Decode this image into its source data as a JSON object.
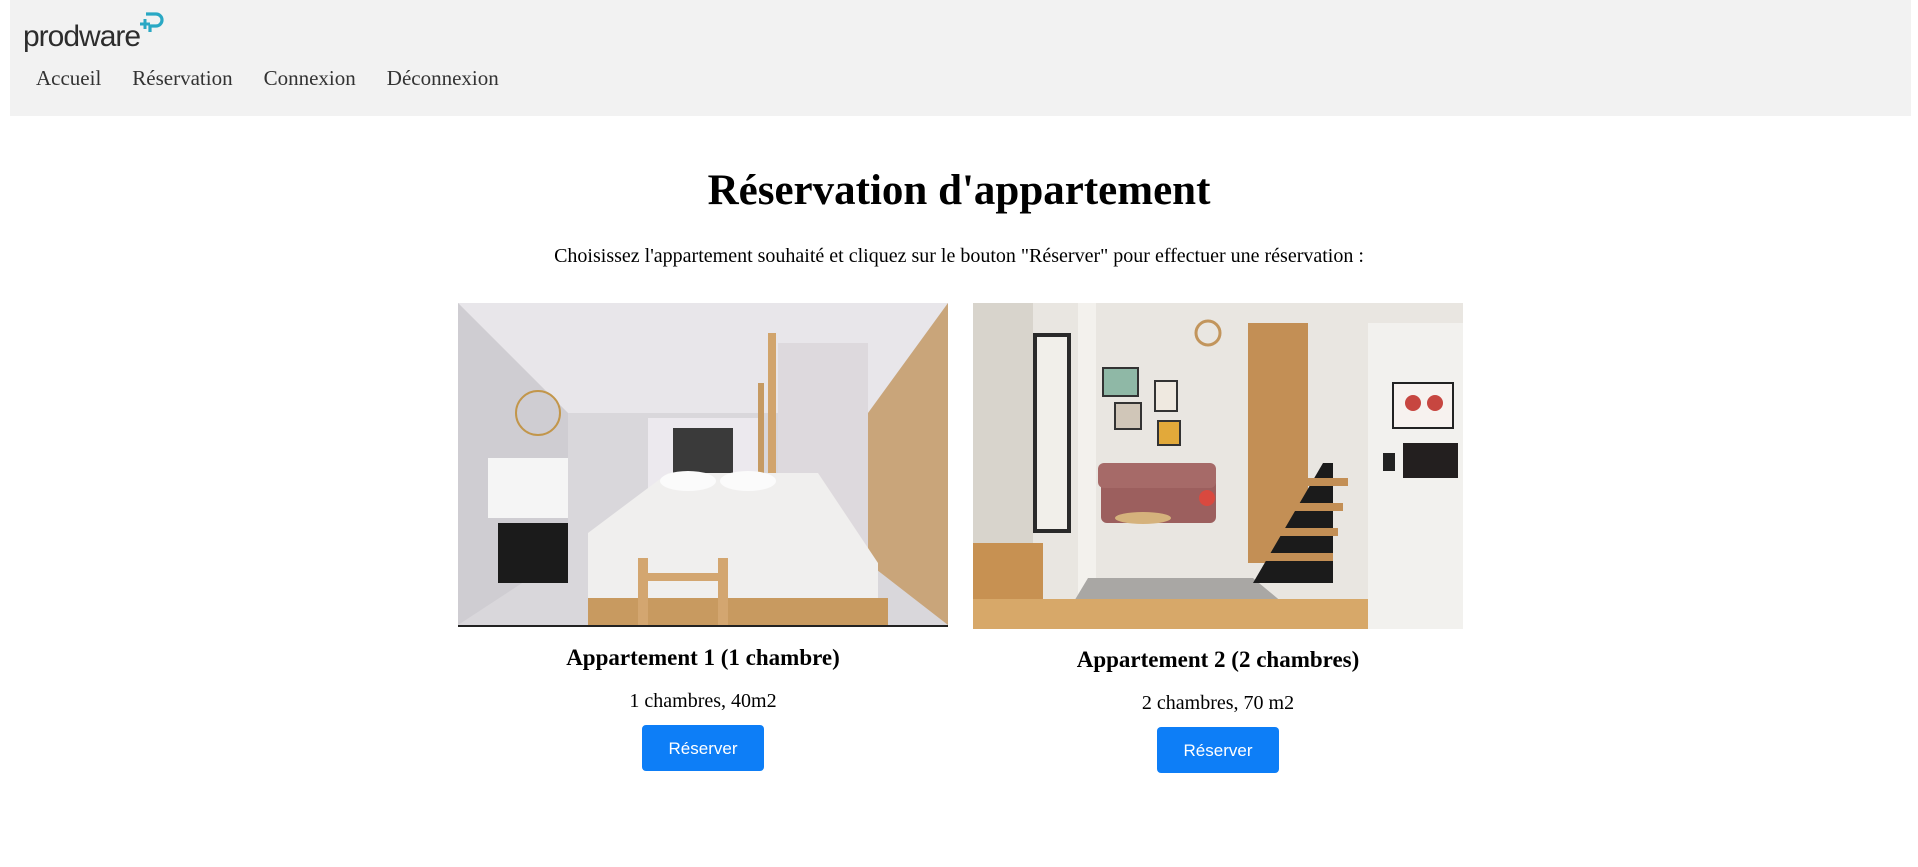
{
  "header": {
    "logo_text": "prodware",
    "nav": [
      {
        "label": "Accueil"
      },
      {
        "label": "Réservation"
      },
      {
        "label": "Connexion"
      },
      {
        "label": "Déconnexion"
      }
    ]
  },
  "main": {
    "title": "Réservation d'appartement",
    "intro": "Choisissez l'appartement souhaité et cliquez sur le bouton \"Réserver\" pour effectuer une réservation :",
    "apartments": [
      {
        "title": "Appartement 1 (1 chambre)",
        "description": "1 chambres, 40m2",
        "button_label": "Réserver",
        "image": "bedroom-photo"
      },
      {
        "title": "Appartement 2 (2 chambres)",
        "description": "2 chambres, 70 m2",
        "button_label": "Réserver",
        "image": "living-room-photo"
      }
    ]
  },
  "colors": {
    "header_bg": "#f2f2f2",
    "button_bg": "#0d7ef7",
    "logo_accent": "#2aa8c4",
    "logo_text": "#2d2d2d"
  }
}
